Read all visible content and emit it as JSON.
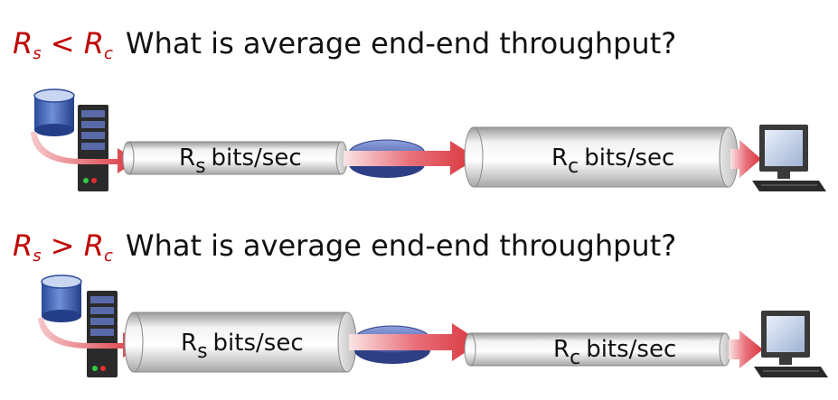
{
  "rows": [
    {
      "condition": {
        "left": "R",
        "left_sub": "s",
        "op": "<",
        "right": "R",
        "right_sub": "c"
      },
      "question": "What is average end-end throughput?",
      "server_link": {
        "symbol": "R",
        "sub": "s",
        "unit": "bits/sec"
      },
      "client_link": {
        "symbol": "R",
        "sub": "c",
        "unit": "bits/sec"
      }
    },
    {
      "condition": {
        "left": "R",
        "left_sub": "s",
        "op": ">",
        "right": "R",
        "right_sub": "c"
      },
      "question": "What is average end-end throughput?",
      "server_link": {
        "symbol": "R",
        "sub": "s",
        "unit": "bits/sec"
      },
      "client_link": {
        "symbol": "R",
        "sub": "c",
        "unit": "bits/sec"
      }
    }
  ],
  "colors": {
    "condition_text": "#c00000",
    "flow_arrow": "#d9343b",
    "pipe": "#dcdcdc",
    "router": "#5b6fb8"
  },
  "icons": [
    "database-icon",
    "server-icon",
    "router-icon",
    "computer-icon"
  ]
}
